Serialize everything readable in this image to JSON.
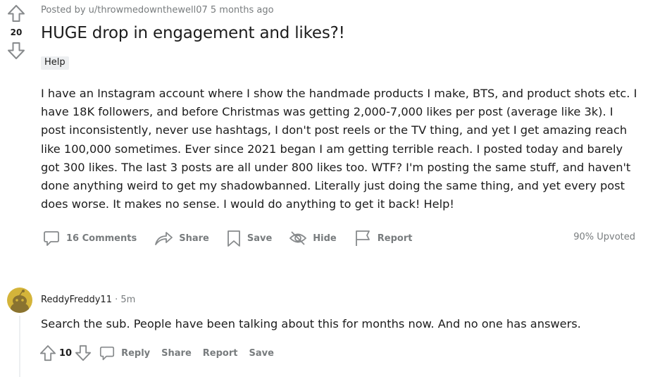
{
  "post": {
    "score": "20",
    "posted_by": "Posted by u/throwmedownthewell07",
    "time_ago": "5 months ago",
    "title": "HUGE drop in engagement and likes?!",
    "flair": "Help",
    "body": "I have an Instagram account where I show the handmade products I make, BTS, and product shots etc. I have 18K followers, and before Christmas was getting 2,000-7,000 likes per post (average like 3k). I post inconsistently, never use hashtags, I don't post reels or the TV thing, and yet I get amazing reach like 100,000 sometimes. Ever since 2021 began I am getting terrible reach. I posted today and barely got 300 likes. The last 3 posts are all under 800 likes too. WTF? I'm posting the same stuff, and haven't done anything weird to get my shadowbanned. Literally just doing the same thing, and yet every post does worse. It makes no sense. I would do anything to get it back! Help!",
    "actions": {
      "comments": "16 Comments",
      "share": "Share",
      "save": "Save",
      "hide": "Hide",
      "report": "Report"
    },
    "upvoted": "90% Upvoted"
  },
  "comment": {
    "author": "ReddyFreddy11",
    "separator": "·",
    "time": "5m",
    "body": "Search the sub. People have been talking about this for months now. And no one has answers.",
    "score": "10",
    "actions": {
      "reply": "Reply",
      "share": "Share",
      "report": "Report",
      "save": "Save"
    }
  },
  "colors": {
    "meta_gray": "#787c7e",
    "text": "#1c1c1c",
    "flair_bg": "#edeff1",
    "avatar": "#d4b43a"
  }
}
